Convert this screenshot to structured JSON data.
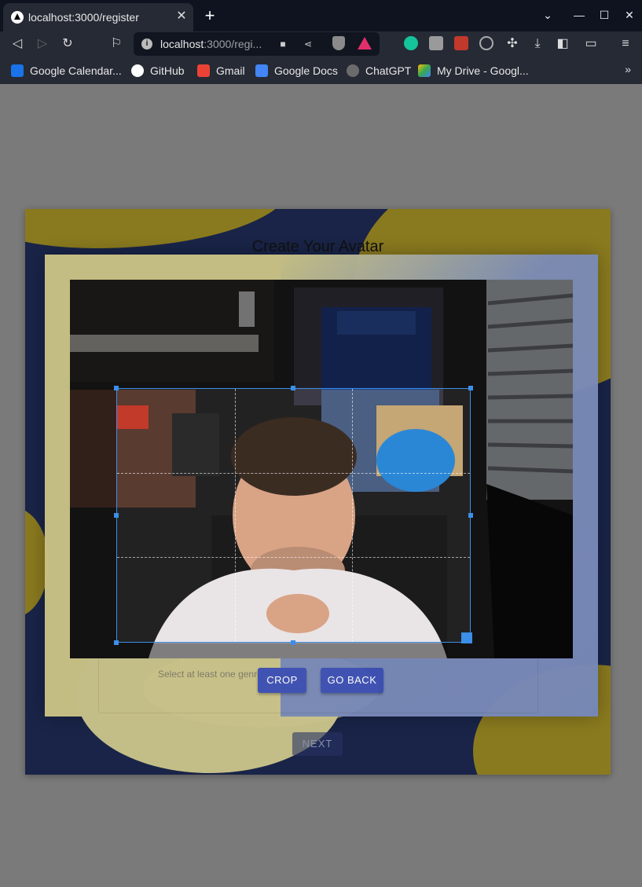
{
  "browser": {
    "tab_title": "localhost:3000/register",
    "url_host": "localhost",
    "url_rest": ":3000/regi...",
    "bookmarks": [
      {
        "label": "Google Calendar...",
        "color": "#1a73e8"
      },
      {
        "label": "GitHub",
        "color": "#ffffff"
      },
      {
        "label": "Gmail",
        "color": "#ea4335"
      },
      {
        "label": "Google Docs",
        "color": "#4285f4"
      },
      {
        "label": "ChatGPT",
        "color": "#6b6b6b"
      },
      {
        "label": "My Drive - Googl...",
        "color": "#fbbc04"
      }
    ],
    "more_bookmarks": "»"
  },
  "page": {
    "heading": "Create Your Avatar",
    "genre_hint": "Select at least one genre",
    "crop_label": "CROP",
    "go_back_label": "GO BACK",
    "next_label": "NEXT"
  },
  "colors": {
    "accent": "#3f51b5",
    "crop_frame": "#3c8ee8",
    "card_blue": "#223060",
    "card_yellow": "#b9a32a"
  },
  "icons": [
    "back-icon",
    "forward-icon",
    "reload-icon",
    "bookmark-icon",
    "camera-icon",
    "share-icon",
    "brave-shield-icon",
    "brave-rewards-icon",
    "grammarly-icon",
    "puzzle-icon",
    "download-icon",
    "sidebar-icon",
    "wallet-icon",
    "menu-icon"
  ]
}
